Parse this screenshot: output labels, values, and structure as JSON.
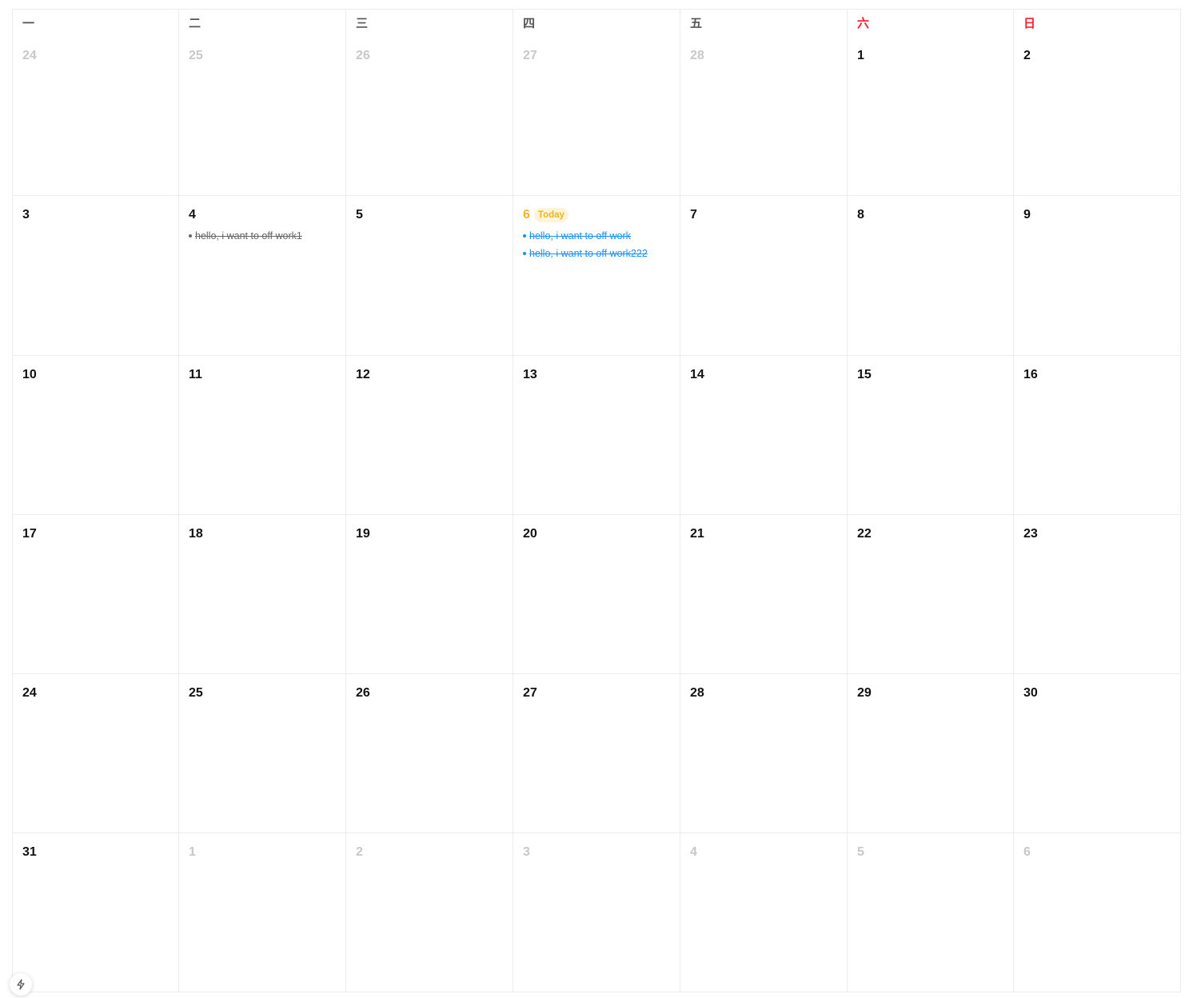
{
  "weekdays": [
    "一",
    "二",
    "三",
    "四",
    "五",
    "六",
    "日"
  ],
  "weekend_color": "#f5222d",
  "today_color": "#f0b429",
  "today_badge_label": "Today",
  "weeks": [
    [
      {
        "day": "24",
        "muted": true
      },
      {
        "day": "25",
        "muted": true
      },
      {
        "day": "26",
        "muted": true
      },
      {
        "day": "27",
        "muted": true
      },
      {
        "day": "28",
        "muted": true
      },
      {
        "day": "1"
      },
      {
        "day": "2"
      }
    ],
    [
      {
        "day": "3"
      },
      {
        "day": "4",
        "events": [
          {
            "text": "hello, i want to off work1",
            "style": "done-gray"
          }
        ]
      },
      {
        "day": "5"
      },
      {
        "day": "6",
        "today": true,
        "events": [
          {
            "text": "hello, i want to off work",
            "style": "done-blue"
          },
          {
            "text": "hello, i want to off work222",
            "style": "done-blue"
          }
        ]
      },
      {
        "day": "7"
      },
      {
        "day": "8"
      },
      {
        "day": "9"
      }
    ],
    [
      {
        "day": "10"
      },
      {
        "day": "11"
      },
      {
        "day": "12"
      },
      {
        "day": "13"
      },
      {
        "day": "14"
      },
      {
        "day": "15"
      },
      {
        "day": "16"
      }
    ],
    [
      {
        "day": "17"
      },
      {
        "day": "18"
      },
      {
        "day": "19"
      },
      {
        "day": "20"
      },
      {
        "day": "21"
      },
      {
        "day": "22"
      },
      {
        "day": "23"
      }
    ],
    [
      {
        "day": "24"
      },
      {
        "day": "25"
      },
      {
        "day": "26"
      },
      {
        "day": "27"
      },
      {
        "day": "28"
      },
      {
        "day": "29"
      },
      {
        "day": "30"
      }
    ],
    [
      {
        "day": "31"
      },
      {
        "day": "1",
        "muted": true
      },
      {
        "day": "2",
        "muted": true
      },
      {
        "day": "3",
        "muted": true
      },
      {
        "day": "4",
        "muted": true
      },
      {
        "day": "5",
        "muted": true
      },
      {
        "day": "6",
        "muted": true
      }
    ]
  ],
  "fab": {
    "icon": "lightning-icon"
  }
}
